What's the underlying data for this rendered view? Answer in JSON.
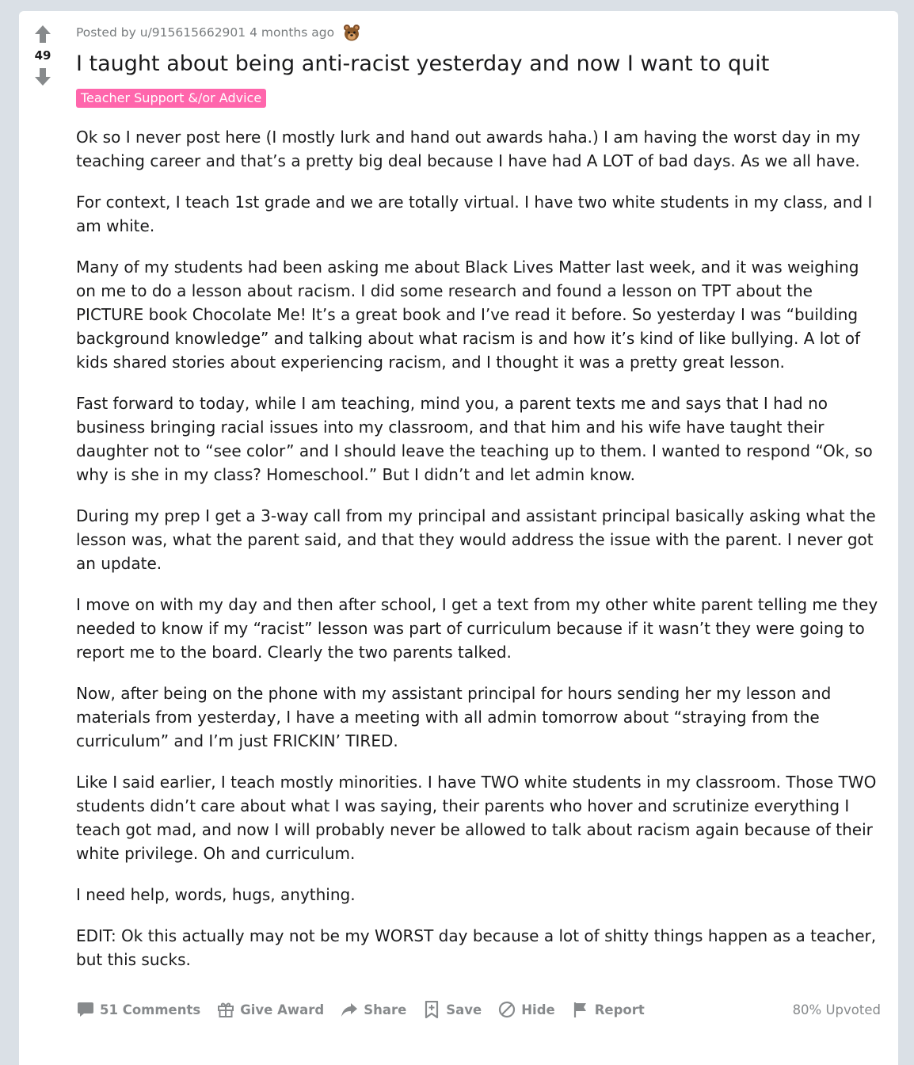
{
  "post": {
    "meta_prefix": "Posted by",
    "author": "u/915615662901",
    "age": "4 months ago",
    "award_icon": "bear-award-icon",
    "title": "I taught about being anti-racist yesterday and now I want to quit",
    "flair": "Teacher Support &/or Advice",
    "score": "49",
    "paragraphs": [
      "Ok so I never post here (I mostly lurk and hand out awards haha.) I am having the worst day in my teaching career and that’s a pretty big deal because I have had A LOT of bad days. As we all have.",
      "For context, I teach 1st grade and we are totally virtual. I have two white students in my class, and I am white.",
      "Many of my students had been asking me about Black Lives Matter last week, and it was weighing on me to do a lesson about racism. I did some research and found a lesson on TPT about the PICTURE book Chocolate Me! It’s a great book and I’ve read it before. So yesterday I was “building background knowledge” and talking about what racism is and how it’s kind of like bullying. A lot of kids shared stories about experiencing racism, and I thought it was a pretty great lesson.",
      "Fast forward to today, while I am teaching, mind you, a parent texts me and says that I had no business bringing racial issues into my classroom, and that him and his wife have taught their daughter not to “see color” and I should leave the teaching up to them. I wanted to respond “Ok, so why is she in my class? Homeschool.” But I didn’t and let admin know.",
      "During my prep I get a 3-way call from my principal and assistant principal basically asking what the lesson was, what the parent said, and that they would address the issue with the parent. I never got an update.",
      "I move on with my day and then after school, I get a text from my other white parent telling me they needed to know if my “racist” lesson was part of curriculum because if it wasn’t they were going to report me to the board. Clearly the two parents talked.",
      "Now, after being on the phone with my assistant principal for hours sending her my lesson and materials from yesterday, I have a meeting with all admin tomorrow about “straying from the curriculum” and I’m just FRICKIN’ TIRED.",
      "Like I said earlier, I teach mostly minorities. I have TWO white students in my classroom. Those TWO students didn’t care about what I was saying, their parents who hover and scrutinize everything I teach got mad, and now I will probably never be allowed to talk about racism again because of their white privilege. Oh and curriculum.",
      "I need help, words, hugs, anything.",
      "EDIT: Ok this actually may not be my WORST day because a lot of shitty things happen as a teacher, but this sucks."
    ]
  },
  "actions": {
    "comments": "51 Comments",
    "give_award": "Give Award",
    "share": "Share",
    "save": "Save",
    "hide": "Hide",
    "report": "Report",
    "upvoted": "80% Upvoted"
  },
  "colors": {
    "flair_bg": "#ff66ac",
    "meta_text": "#787c7e",
    "action_text": "#878a8c",
    "page_bg": "#dae0e6"
  }
}
